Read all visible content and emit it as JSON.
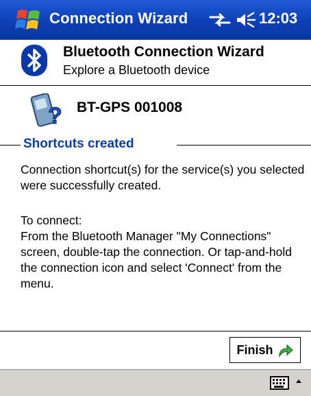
{
  "titlebar": {
    "title": "Connection Wizard",
    "time": "12:03",
    "icons": [
      "windows-flag-icon",
      "connectivity-icon",
      "speaker-icon"
    ],
    "bg": "#0c3fb6"
  },
  "header": {
    "title": "Bluetooth Connection Wizard",
    "subtitle": "Explore a Bluetooth device",
    "icon": "bluetooth-icon"
  },
  "device": {
    "name": "BT-GPS 001008",
    "icon": "device-question-icon"
  },
  "group": {
    "label": "Shortcuts created",
    "color": "#0b3da8"
  },
  "body": {
    "para1": "Connection shortcut(s)  for the service(s) you selected were successfully created.",
    "para2_line1": "To connect:",
    "para2_rest": "From the Bluetooth Manager \"My Connections\" screen, double-tap the connection. Or tap-and-hold the connection icon and select 'Connect' from the menu."
  },
  "buttons": {
    "finish": "Finish"
  },
  "bottombar": {
    "icons": [
      "keyboard-icon",
      "sip-arrow-icon"
    ]
  }
}
